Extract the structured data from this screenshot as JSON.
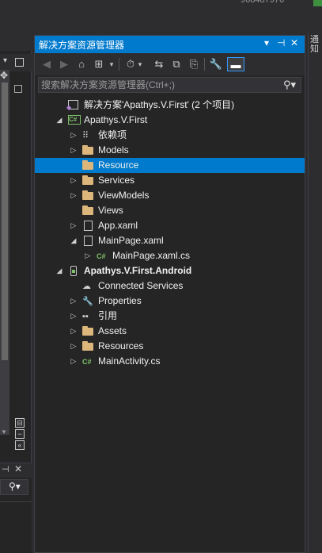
{
  "top": {
    "number_text": "968487976"
  },
  "right_dock": {
    "tab_label": "通知"
  },
  "solution_explorer": {
    "title": "解决方案资源管理器",
    "title_buttons": [
      "▾",
      "⊣",
      "✕"
    ],
    "search_placeholder": "搜索解决方案资源管理器(Ctrl+;)",
    "tree": [
      {
        "label": "解决方案'Apathys.V.First' (2 个项目)",
        "icon": "solution-icon",
        "depth": 0,
        "arrow": "",
        "bold": false,
        "selected": false
      },
      {
        "label": "Apathys.V.First",
        "icon": "csharp-project-icon",
        "depth": 1,
        "arrow": "expanded",
        "bold": false,
        "selected": false
      },
      {
        "label": "依赖项",
        "icon": "dependencies-icon",
        "depth": 2,
        "arrow": "collapsed",
        "bold": false,
        "selected": false
      },
      {
        "label": "Models",
        "icon": "folder-icon",
        "depth": 2,
        "arrow": "collapsed",
        "bold": false,
        "selected": false
      },
      {
        "label": "Resource",
        "icon": "folder-icon",
        "depth": 2,
        "arrow": "",
        "bold": false,
        "selected": true
      },
      {
        "label": "Services",
        "icon": "folder-icon",
        "depth": 2,
        "arrow": "collapsed",
        "bold": false,
        "selected": false
      },
      {
        "label": "ViewModels",
        "icon": "folder-icon",
        "depth": 2,
        "arrow": "collapsed",
        "bold": false,
        "selected": false
      },
      {
        "label": "Views",
        "icon": "folder-icon",
        "depth": 2,
        "arrow": "",
        "bold": false,
        "selected": false
      },
      {
        "label": "App.xaml",
        "icon": "xaml-file-icon",
        "depth": 2,
        "arrow": "collapsed",
        "bold": false,
        "selected": false
      },
      {
        "label": "MainPage.xaml",
        "icon": "xaml-file-icon",
        "depth": 2,
        "arrow": "expanded",
        "bold": false,
        "selected": false
      },
      {
        "label": "MainPage.xaml.cs",
        "icon": "csharp-file-icon",
        "depth": 3,
        "arrow": "collapsed",
        "bold": false,
        "selected": false
      },
      {
        "label": "Apathys.V.First.Android",
        "icon": "android-project-icon",
        "depth": 1,
        "arrow": "expanded",
        "bold": true,
        "selected": false
      },
      {
        "label": "Connected Services",
        "icon": "connected-services-icon",
        "depth": 2,
        "arrow": "",
        "bold": false,
        "selected": false
      },
      {
        "label": "Properties",
        "icon": "wrench-icon",
        "depth": 2,
        "arrow": "collapsed",
        "bold": false,
        "selected": false
      },
      {
        "label": "引用",
        "icon": "references-icon",
        "depth": 2,
        "arrow": "collapsed",
        "bold": false,
        "selected": false
      },
      {
        "label": "Assets",
        "icon": "folder-icon",
        "depth": 2,
        "arrow": "collapsed",
        "bold": false,
        "selected": false
      },
      {
        "label": "Resources",
        "icon": "folder-icon",
        "depth": 2,
        "arrow": "collapsed",
        "bold": false,
        "selected": false
      },
      {
        "label": "MainActivity.cs",
        "icon": "csharp-file-icon",
        "depth": 2,
        "arrow": "collapsed",
        "bold": false,
        "selected": false
      }
    ]
  },
  "colors": {
    "accent": "#007acc",
    "background": "#252526",
    "folder": "#dcb67a",
    "csharp": "#7ec269"
  }
}
